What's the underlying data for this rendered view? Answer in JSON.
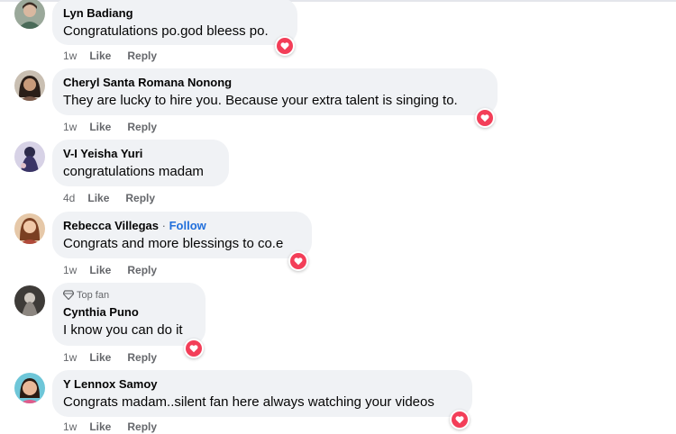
{
  "comments": [
    {
      "name": "Lyn Badiang",
      "text": "Congratulations po.god bleess po.",
      "time": "1w",
      "like": "Like",
      "reply": "Reply",
      "reaction": "heart-icon"
    },
    {
      "name": "Cheryl Santa Romana Nonong",
      "text": "They are lucky to hire you. Because your extra talent is singing to.",
      "time": "1w",
      "like": "Like",
      "reply": "Reply",
      "reaction": "heart-icon"
    },
    {
      "name": "V-I Yeisha Yuri",
      "text": "congratulations madam",
      "time": "4d",
      "like": "Like",
      "reply": "Reply"
    },
    {
      "name": "Rebecca Villegas",
      "separator": "·",
      "follow": "Follow",
      "text": "Congrats and more blessings to co.e",
      "time": "1w",
      "like": "Like",
      "reply": "Reply",
      "reaction": "heart-icon"
    },
    {
      "badge": "Top fan",
      "name": "Cynthia Puno",
      "text": "I know you can do it",
      "time": "1w",
      "like": "Like",
      "reply": "Reply",
      "reaction": "heart-icon"
    },
    {
      "name": "Y Lennox Samoy",
      "text": "Congrats madam..silent fan here always watching your videos",
      "time": "1w",
      "like": "Like",
      "reply": "Reply",
      "reaction": "heart-icon"
    }
  ],
  "colors": {
    "bubble": "#f0f2f5",
    "link": "#216fdb",
    "meta": "#65676b",
    "heart": "#f33e58"
  }
}
